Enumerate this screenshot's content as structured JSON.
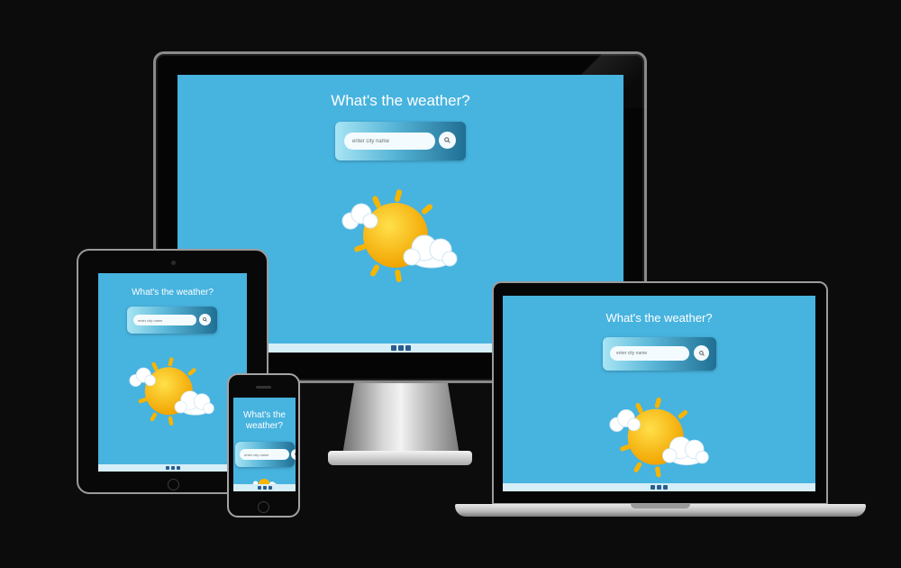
{
  "app": {
    "heading": "What's the weather?",
    "search": {
      "placeholder": "enter city name",
      "button_icon": "search-icon"
    },
    "footer": {
      "social_icons": [
        "facebook-icon",
        "twitter-icon",
        "instagram-icon"
      ]
    },
    "weather_icon": "partly-sunny-icon"
  },
  "colors": {
    "screen_bg": "#47b3df",
    "footer_bg": "#d5eef7",
    "sun": "#f7b500",
    "cloud": "#ffffff"
  }
}
